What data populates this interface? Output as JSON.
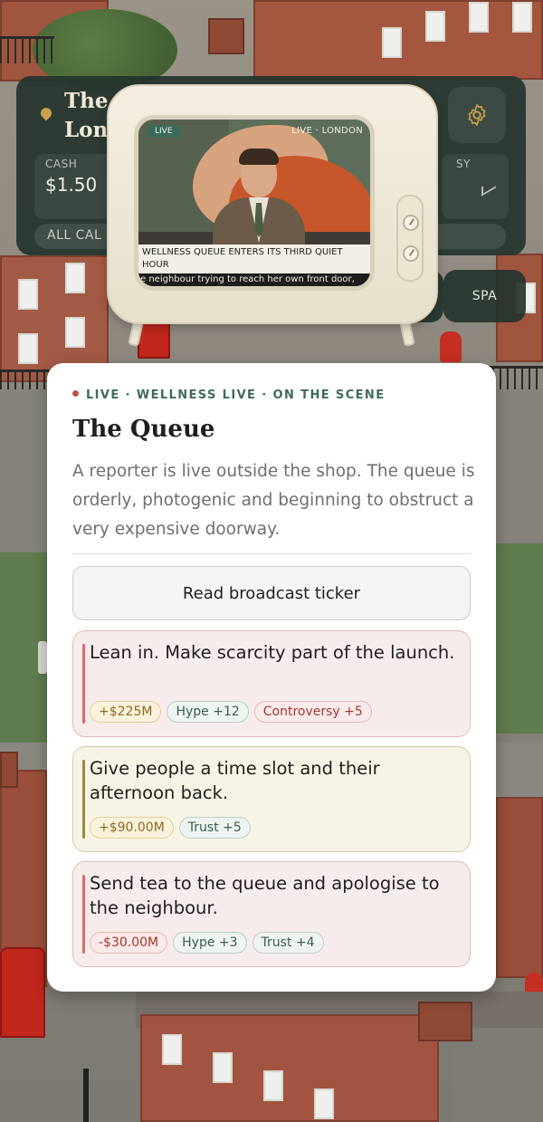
{
  "hud": {
    "city_title": "The\nLon",
    "cash_label": "CASH",
    "cash_value": "$1.50",
    "right_stat_label": "SY",
    "filter_label": "ALL CAL",
    "spa_label": "SPA"
  },
  "tv": {
    "live_badge": "LIVE",
    "location_badge": "LIVE · LONDON",
    "headline": "WELLNESS QUEUE ENTERS ITS THIRD QUIET HOUR",
    "ticker": "e neighbour trying to reach her own front door,"
  },
  "event": {
    "eyebrow": "LIVE · WELLNESS LIVE · ON THE SCENE",
    "title": "The Queue",
    "body": "A reporter is live outside the shop. The queue is orderly, photogenic and beginning to obstruct a very expensive doorway.",
    "read_button": "Read broadcast ticker",
    "choices": [
      {
        "label": "Lean in. Make scarcity part of the launch.",
        "accent": "#d9686a",
        "tags": [
          "+$225M",
          "Hype +12",
          "Controversy +5"
        ]
      },
      {
        "label": "Give people a time slot and their afternoon back.",
        "accent": "#9a8a3d",
        "tags": [
          "+$90.00M",
          "Trust +5"
        ]
      },
      {
        "label": "Send tea to the queue and apologise to the neighbour.",
        "accent": "#d9686a",
        "tags": [
          "-$30.00M",
          "Hype +3",
          "Trust +4"
        ]
      }
    ]
  },
  "icons": {
    "location": "map-pin-icon",
    "settings": "gear-icon",
    "trend": "trend-up-icon"
  }
}
